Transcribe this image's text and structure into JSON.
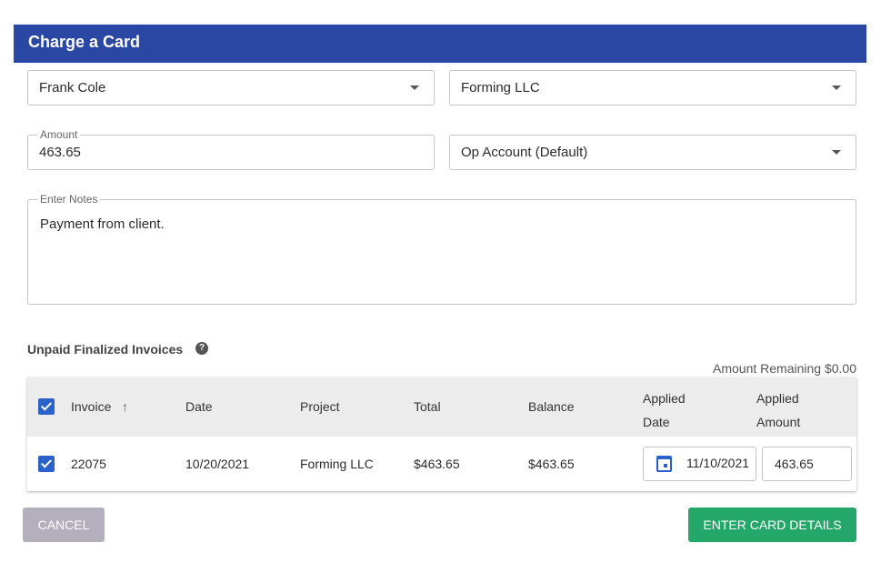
{
  "header": {
    "title": "Charge a Card"
  },
  "form": {
    "client": "Frank Cole",
    "matter": "Forming LLC",
    "amount_label": "Amount",
    "amount": "463.65",
    "account": "Op Account (Default)",
    "notes_label": "Enter Notes",
    "notes": "Payment from client."
  },
  "invoices": {
    "title": "Unpaid Finalized Invoices",
    "remaining": "Amount Remaining $0.00",
    "columns": [
      "Invoice",
      "Date",
      "Project",
      "Total",
      "Balance",
      "Applied Date",
      "Applied Amount"
    ],
    "rows": [
      {
        "invoice": "22075",
        "date": "10/20/2021",
        "project": "Forming LLC",
        "total": "$463.65",
        "balance": "$463.65",
        "applied_date": "11/10/2021",
        "applied_amount": "463.65",
        "checked": true
      }
    ]
  },
  "actions": {
    "cancel": "CANCEL",
    "enter_card": "ENTER CARD DETAILS"
  },
  "colors": {
    "header": "#2a47a3",
    "checkbox": "#2a62c9",
    "primary_button": "#24a869",
    "cancel_button": "#b3afbd"
  },
  "icons": [
    "chevron-down-icon",
    "help-icon",
    "arrow-up-icon",
    "checkbox-icon",
    "calendar-icon"
  ]
}
